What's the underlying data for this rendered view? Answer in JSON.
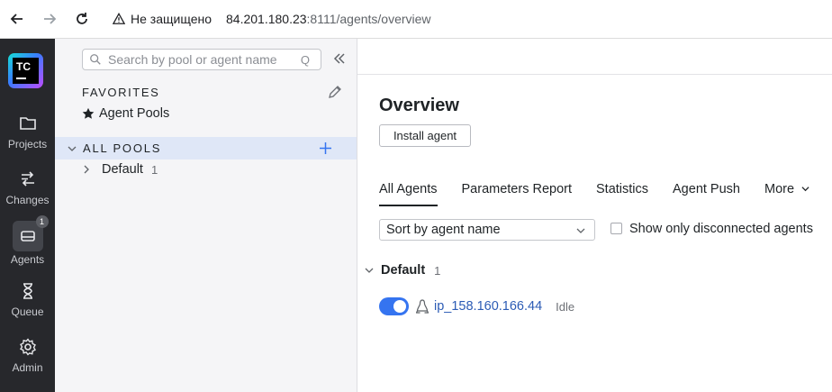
{
  "browser": {
    "security_label": "Не защищено",
    "url_host": "84.201.180.23",
    "url_rest": ":8111/agents/overview"
  },
  "leftnav": {
    "logo_text": "TC",
    "items": [
      {
        "label": "Projects",
        "icon": "folder-icon"
      },
      {
        "label": "Changes",
        "icon": "changes-icon"
      },
      {
        "label": "Agents",
        "icon": "agents-icon",
        "badge": "1"
      },
      {
        "label": "Queue",
        "icon": "hourglass-icon"
      },
      {
        "label": "Admin",
        "icon": "gear-icon"
      }
    ]
  },
  "sidebar": {
    "search_placeholder": "Search by pool or agent name",
    "search_shortcut": "Q",
    "favorites_title": "FAVORITES",
    "favorites_item": "Agent Pools",
    "all_pools_title": "ALL POOLS",
    "pool_name": "Default",
    "pool_count": "1"
  },
  "main": {
    "title": "Overview",
    "install_button": "Install agent",
    "tabs": [
      "All Agents",
      "Parameters Report",
      "Statistics",
      "Agent Push",
      "More"
    ],
    "sort_value": "Sort by agent name",
    "disconnected_label": "Show only disconnected agents",
    "group_name": "Default",
    "group_count": "1",
    "agent_name": "ip_158.160.166.44",
    "agent_status": "Idle"
  },
  "colors": {
    "nav_bg": "#27282c",
    "sidebar_bg": "#f5f5f7",
    "selected_row": "#dfe7f7",
    "accent": "#3574f0",
    "link": "#2b5bb5"
  }
}
